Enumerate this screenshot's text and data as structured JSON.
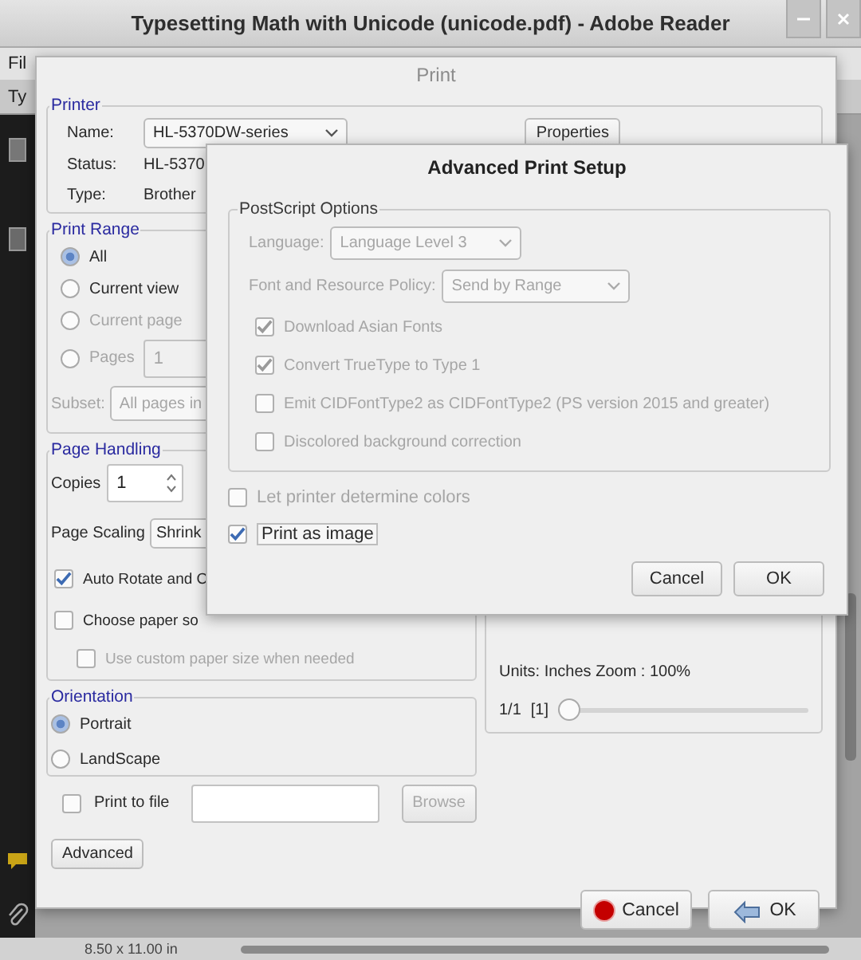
{
  "app_window": {
    "title": "Typesetting Math with Unicode (unicode.pdf) - Adobe Reader",
    "menu": [
      "Fil"
    ],
    "toolbar_text": "Ty",
    "status_bar": {
      "page_size": "8.50 x 11.00 in"
    }
  },
  "print_dialog": {
    "title": "Print",
    "printer": {
      "legend": "Printer",
      "name_label": "Name:",
      "name_value": "HL-5370DW-series",
      "properties_button": "Properties",
      "status_label": "Status:",
      "status_value": "HL-5370",
      "type_label": "Type:",
      "type_value": "Brother"
    },
    "print_range": {
      "legend": "Print Range",
      "options": [
        {
          "label": "All",
          "selected": true,
          "disabled": false
        },
        {
          "label": "Current view",
          "selected": false,
          "disabled": false
        },
        {
          "label": "Current page",
          "selected": false,
          "disabled": true
        },
        {
          "label": "Pages",
          "selected": false,
          "disabled": true,
          "value": "1"
        }
      ],
      "subset_label": "Subset:",
      "subset_value": "All pages in",
      "subset_disabled": true
    },
    "page_handling": {
      "legend": "Page Handling",
      "copies_label": "Copies",
      "copies_value": "1",
      "scaling_label": "Page Scaling",
      "scaling_value": "Shrink",
      "options": [
        {
          "label": "Auto Rotate and C",
          "checked": true,
          "disabled": false
        },
        {
          "label": "Choose paper so",
          "checked": false,
          "disabled": false,
          "children": [
            {
              "label": "Use custom paper size when needed",
              "checked": false,
              "disabled": true
            }
          ]
        }
      ]
    },
    "orientation": {
      "legend": "Orientation",
      "options": [
        {
          "label": "Portrait",
          "selected": true
        },
        {
          "label": "LandScape",
          "selected": false
        }
      ]
    },
    "print_to_file": {
      "label": "Print to file",
      "checked": false,
      "browse_button": "Browse",
      "browse_disabled": true
    },
    "advanced_button": "Advanced",
    "preview": {
      "units_text": "Units: Inches Zoom : 100%",
      "page_count": "1/1",
      "page_index": "[1]",
      "level": 0
    },
    "buttons": [
      {
        "label": "Cancel",
        "kind": "cancel"
      },
      {
        "label": "OK",
        "kind": "ok"
      }
    ]
  },
  "advanced_dialog": {
    "title": "Advanced Print Setup",
    "postscript": {
      "legend": "PostScript Options",
      "disabled": true,
      "language_label": "Language:",
      "language_value": "Language Level 3",
      "policy_label": "Font and Resource Policy:",
      "policy_value": "Send by Range",
      "options": [
        {
          "label": "Download Asian Fonts",
          "checked": true
        },
        {
          "label": "Convert TrueType to Type 1",
          "checked": true
        },
        {
          "label": "Emit CIDFontType2 as CIDFontType2 (PS version 2015 and greater)",
          "checked": false
        },
        {
          "label": "Discolored background correction",
          "checked": false
        }
      ]
    },
    "options": [
      {
        "label": "Let printer determine colors",
        "checked": false,
        "disabled": true,
        "focused": false
      },
      {
        "label": "Print as image",
        "checked": true,
        "disabled": false,
        "focused": true
      }
    ],
    "buttons": [
      "Cancel",
      "OK"
    ]
  }
}
